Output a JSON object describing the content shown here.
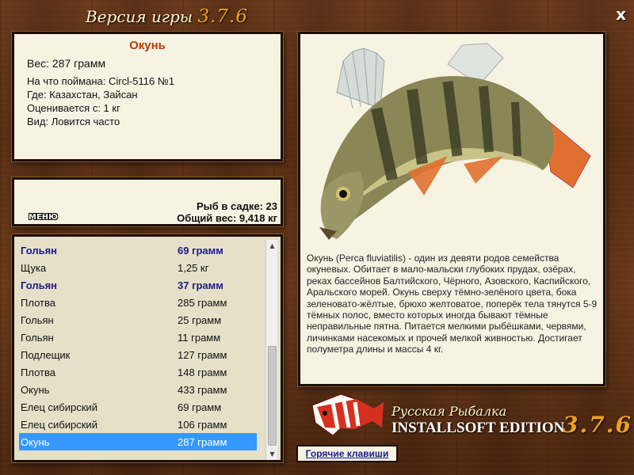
{
  "window": {
    "title": "Версия игры",
    "version": "3.7.6",
    "close_label": "x"
  },
  "catch_info": {
    "name": "Окунь",
    "weight": "Вес: 287 грамм",
    "bait": "На что поймана: Circl-5116 №1",
    "location": "Где: Казахстан, Зайсан",
    "rated_from": "Оценивается с: 1 кг",
    "frequency": "Вид: Ловится часто"
  },
  "stats": {
    "menu_label": "МЕНЮ",
    "fish_in_keepnet": "Рыб в садке: 23",
    "total_weight": "Общий вес: 9,418 кг"
  },
  "catch_list": [
    {
      "name": "Гольян",
      "weight": "69 грамм",
      "bold": true
    },
    {
      "name": "Щука",
      "weight": "1,25 кг",
      "bold": false
    },
    {
      "name": "Гольян",
      "weight": "37 грамм",
      "bold": true
    },
    {
      "name": "Плотва",
      "weight": "285 грамм",
      "bold": false
    },
    {
      "name": "Гольян",
      "weight": "25 грамм",
      "bold": false
    },
    {
      "name": "Гольян",
      "weight": "11 грамм",
      "bold": false
    },
    {
      "name": "Подлещик",
      "weight": "127 грамм",
      "bold": false
    },
    {
      "name": "Плотва",
      "weight": "148 грамм",
      "bold": false
    },
    {
      "name": "Окунь",
      "weight": "433 грамм",
      "bold": false
    },
    {
      "name": "Елец сибирский",
      "weight": "69 грамм",
      "bold": false
    },
    {
      "name": "Елец сибирский",
      "weight": "106 грамм",
      "bold": false
    },
    {
      "name": "Окунь",
      "weight": "287 грамм",
      "bold": false,
      "selected": true
    }
  ],
  "description": "Окунь (Perca fluviatilis) - один из девяти родов семейства окуневых. Обитает в мало-мальски глубоких прудах, озёрах, реках бассейнов Балтийского, Чёрного, Азовского, Каспийского, Аральского морей. Окунь сверху тёмно-зелёного цвета, бока зеленовато-жёлтые, брюхо желтоватое, поперёк тела тянутся 5-9 тёмных полос, вместо которых иногда бывают тёмные неправильные пятна. Питается мелкими рыбёшками, червями, личинками насекомых и прочей мелкой живностью. Достигает полуметра длины и массы 4 кг.",
  "brand": {
    "title": "Русская Рыбалка",
    "edition": "INSTALLSOFT EDITION",
    "version": "3.7.6"
  },
  "hotkeys_label": "Горячие клавиши",
  "colors": {
    "accent_name": "#b83c00",
    "version_orange": "#f0a020",
    "list_bold": "#1a1a8a",
    "selection": "#3399ff"
  }
}
